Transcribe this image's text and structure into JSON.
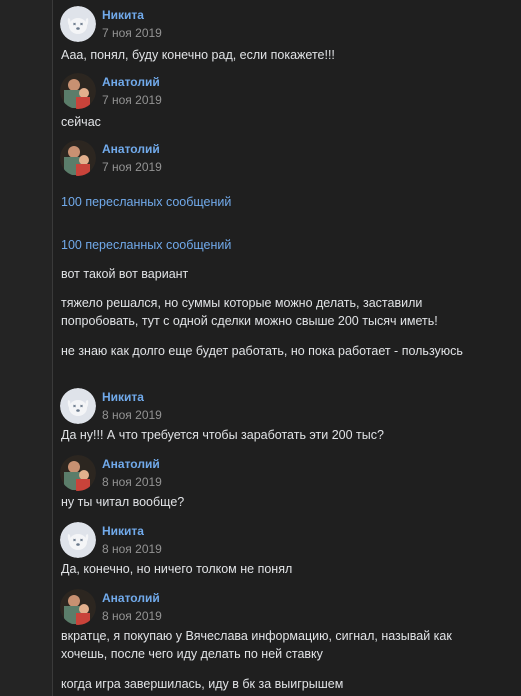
{
  "messages": [
    {
      "author": "Никита",
      "date": "7 ноя 2019",
      "text": "Ааа, понял, буду конечно рад, если покажете!!!"
    },
    {
      "author": "Анатолий",
      "date": "7 ноя 2019",
      "text": "сейчас"
    },
    {
      "author": "Анатолий",
      "date": "7 ноя 2019"
    },
    {
      "forwarded_1": "100 пересланных сообщений",
      "forwarded_2": "100 пересланных сообщений",
      "text_1": "вот такой вот вариант",
      "text_2": "тяжело решался, но суммы которые можно делать, заставили попробовать, тут с одной сделки можно свыше 200 тысяч иметь!",
      "text_3": "не знаю как долго еще будет работать, но пока работает - пользуюсь"
    },
    {
      "author": "Никита",
      "date": "8 ноя 2019",
      "text": "Да ну!!! А что требуется чтобы заработать эти 200 тыс?"
    },
    {
      "author": "Анатолий",
      "date": "8 ноя 2019",
      "text": "ну ты читал вообще?"
    },
    {
      "author": "Никита",
      "date": "8 ноя 2019",
      "text": "Да, конечно, но ничего толком не понял"
    },
    {
      "author": "Анатолий",
      "date": "8 ноя 2019",
      "text_1": "вкратце, я покупаю у Вячеслава информацию, сигнал, называй как хочешь, после чего иду делать по ней ставку",
      "text_2": "когда игра завершилась, иду в бк за выигрышем"
    }
  ],
  "colors": {
    "background": "#1f1f1f",
    "author": "#71aaeb",
    "text": "#e1e3e6",
    "date": "#939393",
    "link": "#71aaeb"
  },
  "icons": {
    "nikita_avatar": "vk-dog-avatar-icon",
    "anatoly_avatar": "photo-avatar-icon"
  }
}
